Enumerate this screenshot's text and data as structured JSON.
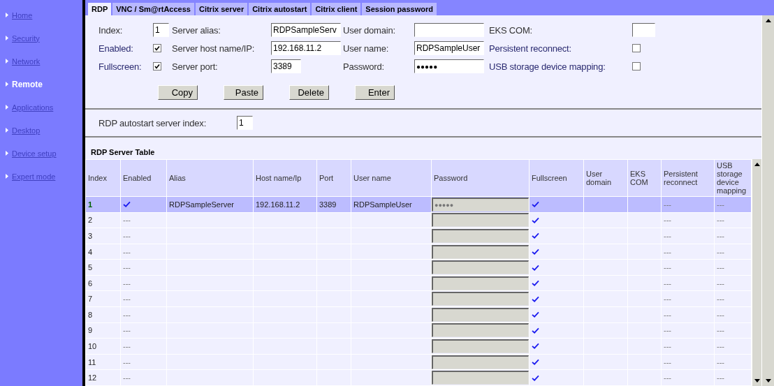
{
  "sidebar": {
    "items": [
      {
        "label": "Home",
        "selected": false
      },
      {
        "label": "Security",
        "selected": false
      },
      {
        "label": "Network",
        "selected": false
      },
      {
        "label": "Remote",
        "selected": true
      },
      {
        "label": "Applications",
        "selected": false
      },
      {
        "label": "Desktop",
        "selected": false
      },
      {
        "label": "Device setup",
        "selected": false
      },
      {
        "label": "Expert mode",
        "selected": false
      }
    ]
  },
  "tabs": [
    {
      "label": "RDP",
      "selected": true
    },
    {
      "label": "VNC / Sm@rtAccess",
      "selected": false
    },
    {
      "label": "Citrix server",
      "selected": false
    },
    {
      "label": "Citrix autostart",
      "selected": false
    },
    {
      "label": "Citrix client",
      "selected": false
    },
    {
      "label": "Session password",
      "selected": false
    }
  ],
  "form": {
    "index": {
      "label": "Index:",
      "value": "1"
    },
    "enabled": {
      "label": "Enabled:",
      "checked": true
    },
    "fullscreen": {
      "label": "Fullscreen:",
      "checked": true
    },
    "server_alias": {
      "label": "Server alias:",
      "value": "RDPSampleServ"
    },
    "server_host": {
      "label": "Server host name/IP:",
      "value": "192.168.11.2"
    },
    "server_port": {
      "label": "Server port:",
      "value": "3389"
    },
    "user_domain": {
      "label": "User domain:"
    },
    "user_name": {
      "label": "User name:",
      "value": "RDPSampleUser"
    },
    "password": {
      "label": "Password:",
      "value": "●●●●●"
    },
    "eks_com": {
      "label": "EKS COM:"
    },
    "persistent_reconnect": {
      "label": "Persistent reconnect:",
      "checked": false
    },
    "usb_mapping": {
      "label": "USB storage device mapping:",
      "checked": false
    },
    "buttons": [
      "Copy",
      "Paste",
      "Delete",
      "Enter"
    ]
  },
  "autostart": {
    "label": "RDP autostart server index:",
    "value": "1"
  },
  "table": {
    "title": "RDP Server Table",
    "columns": [
      "Index",
      "Enabled",
      "Alias",
      "Host name/Ip",
      "Port",
      "User name",
      "Password",
      "Fullscreen",
      "User domain",
      "EKS COM",
      "Persistent reconnect",
      "USB storage device mapping"
    ],
    "rows": [
      {
        "index": "1",
        "selected": true,
        "enabled": true,
        "alias": "RDPSampleServer",
        "host": "192.168.11.2",
        "port": "3389",
        "user": "RDPSampleUser",
        "password": "●●●●●",
        "fullscreen": true,
        "persistent": "---",
        "usb": "---"
      },
      {
        "index": "2",
        "selected": false,
        "enabled": false,
        "enabled_text": "---",
        "fullscreen": true,
        "persistent": "---",
        "usb": "---"
      },
      {
        "index": "3",
        "selected": false,
        "enabled": false,
        "enabled_text": "---",
        "fullscreen": true,
        "persistent": "---",
        "usb": "---"
      },
      {
        "index": "4",
        "selected": false,
        "enabled": false,
        "enabled_text": "---",
        "fullscreen": true,
        "persistent": "---",
        "usb": "---"
      },
      {
        "index": "5",
        "selected": false,
        "enabled": false,
        "enabled_text": "---",
        "fullscreen": true,
        "persistent": "---",
        "usb": "---"
      },
      {
        "index": "6",
        "selected": false,
        "enabled": false,
        "enabled_text": "---",
        "fullscreen": true,
        "persistent": "---",
        "usb": "---"
      },
      {
        "index": "7",
        "selected": false,
        "enabled": false,
        "enabled_text": "---",
        "fullscreen": true,
        "persistent": "---",
        "usb": "---"
      },
      {
        "index": "8",
        "selected": false,
        "enabled": false,
        "enabled_text": "---",
        "fullscreen": true,
        "persistent": "---",
        "usb": "---"
      },
      {
        "index": "9",
        "selected": false,
        "enabled": false,
        "enabled_text": "---",
        "fullscreen": true,
        "persistent": "---",
        "usb": "---"
      },
      {
        "index": "10",
        "selected": false,
        "enabled": false,
        "enabled_text": "---",
        "fullscreen": true,
        "persistent": "---",
        "usb": "---"
      },
      {
        "index": "11",
        "selected": false,
        "enabled": false,
        "enabled_text": "---",
        "fullscreen": true,
        "persistent": "---",
        "usb": "---"
      },
      {
        "index": "12",
        "selected": false,
        "enabled": false,
        "enabled_text": "---",
        "fullscreen": true,
        "persistent": "---",
        "usb": "---"
      }
    ]
  }
}
